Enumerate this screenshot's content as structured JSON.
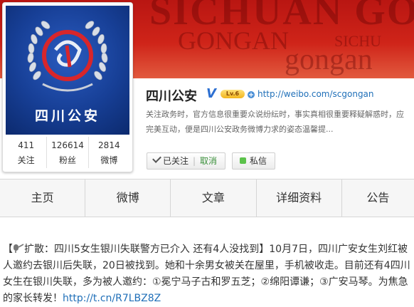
{
  "banner": {
    "watermark_1": "SICHUAN GO",
    "watermark_2": "GONGAN",
    "watermark_3": "SICHU",
    "watermark_4": "gongan"
  },
  "avatar": {
    "name": "四川公安"
  },
  "stats": [
    {
      "value": "411",
      "label": "关注"
    },
    {
      "value": "126614",
      "label": "粉丝"
    },
    {
      "value": "2814",
      "label": "微博"
    }
  ],
  "profile": {
    "name": "四川公安",
    "verified_mark": "V",
    "level_badge": "Lv.6",
    "url": "http://weibo.com/scgongan",
    "description": "关注政务时，官方信息很重要众说纷纭时，事实真相很重要释疑解惑时，应完美互动，便是四川公安政务微博力求的姿态温馨提..."
  },
  "actions": {
    "followed_label": "已关注",
    "separator": "|",
    "cancel_label": "取消",
    "message_label": "私信"
  },
  "nav": {
    "tabs": [
      "主页",
      "微博",
      "文章",
      "详细资料",
      "公告"
    ]
  },
  "post": {
    "prefix": "【",
    "headline": "扩散：四川5女生银川失联警方已介入 还有4人没找到",
    "close": "】",
    "body": "10月7日，四川广安女生刘红被人邀约去银川后失联，20日被找到。她和十余男女被关在屋里，手机被收走。目前还有4四川女生在银川失联，多为被人邀约：①冕宁马子古和罗五芝；②绵阳谭谦；③广安马琴。为焦急的家长转发！",
    "link": "http://t.cn/R7LBZ8Z"
  }
}
